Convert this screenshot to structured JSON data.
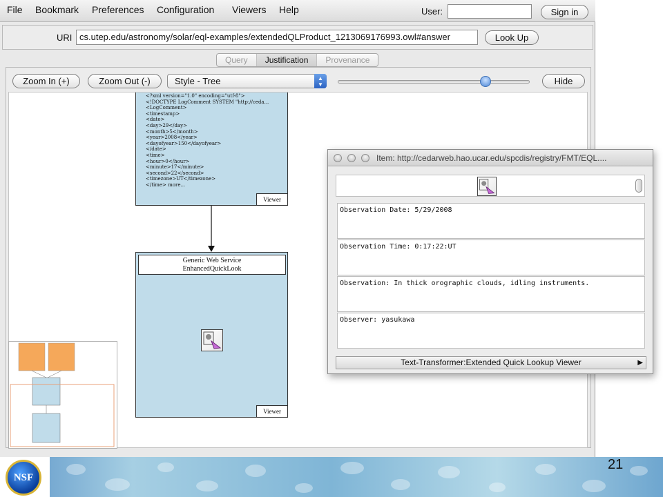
{
  "menu": {
    "items": [
      "File",
      "Bookmark",
      "Preferences",
      "Configuration",
      "Viewers",
      "Help"
    ]
  },
  "account": {
    "user_label": "User:",
    "user_value": "",
    "sign_in_label": "Sign in"
  },
  "uri_bar": {
    "label": "URI",
    "value": "cs.utep.edu/astronomy/solar/eql-examples/extendedQLProduct_1213069176993.owl#answer",
    "lookup_label": "Look Up"
  },
  "tabs": [
    {
      "label": "Query"
    },
    {
      "label": "Justification"
    },
    {
      "label": "Provenance"
    }
  ],
  "toolbar": {
    "zoom_in_label": "Zoom In (+)",
    "zoom_out_label": "Zoom Out (-)",
    "style_value": "Style - Tree",
    "hide_label": "Hide",
    "zoom_level": 0.77
  },
  "graph": {
    "node1": {
      "xml_lines": [
        "<?xml version=\"1.0\" encoding=\"utf-8\">",
        "<!DOCTYPE LogComment SYSTEM \"http://ceda...",
        "<LogComment>",
        "<timestamp>",
        "<date>",
        "<day>29</day>",
        "<month>5</month>",
        "<year>2008</year>",
        "<dayofyear>150</dayofyear>",
        "</date>",
        "<time>",
        "<hour>0</hour>",
        "<minute>17</minute>",
        "<second>22</second>",
        "<timezone>UT</timezone>",
        "</time> more..."
      ],
      "viewer_label": "Viewer"
    },
    "node2": {
      "title_line1": "Generic Web Service",
      "title_line2": "EnhancedQuickLook",
      "viewer_label": "Viewer"
    }
  },
  "item_window": {
    "title": "Item: http://cedarweb.hao.ucar.edu/spcdis/registry/FMT/EQL....",
    "rows": [
      "Observation Date: 5/29/2008",
      "Observation Time: 0:17:22:UT",
      "Observation: In thick orographic clouds, idling instruments.",
      "Observer: yasukawa"
    ],
    "footer_label": "Text-Transformer:Extended Quick Lookup Viewer"
  },
  "footer": {
    "page_number": "21",
    "logo_text": "NSF"
  },
  "colors": {
    "node_fill": "#c0dcea",
    "minimap_orange": "#f5a85a",
    "accent_blue": "#3d6fb4"
  }
}
